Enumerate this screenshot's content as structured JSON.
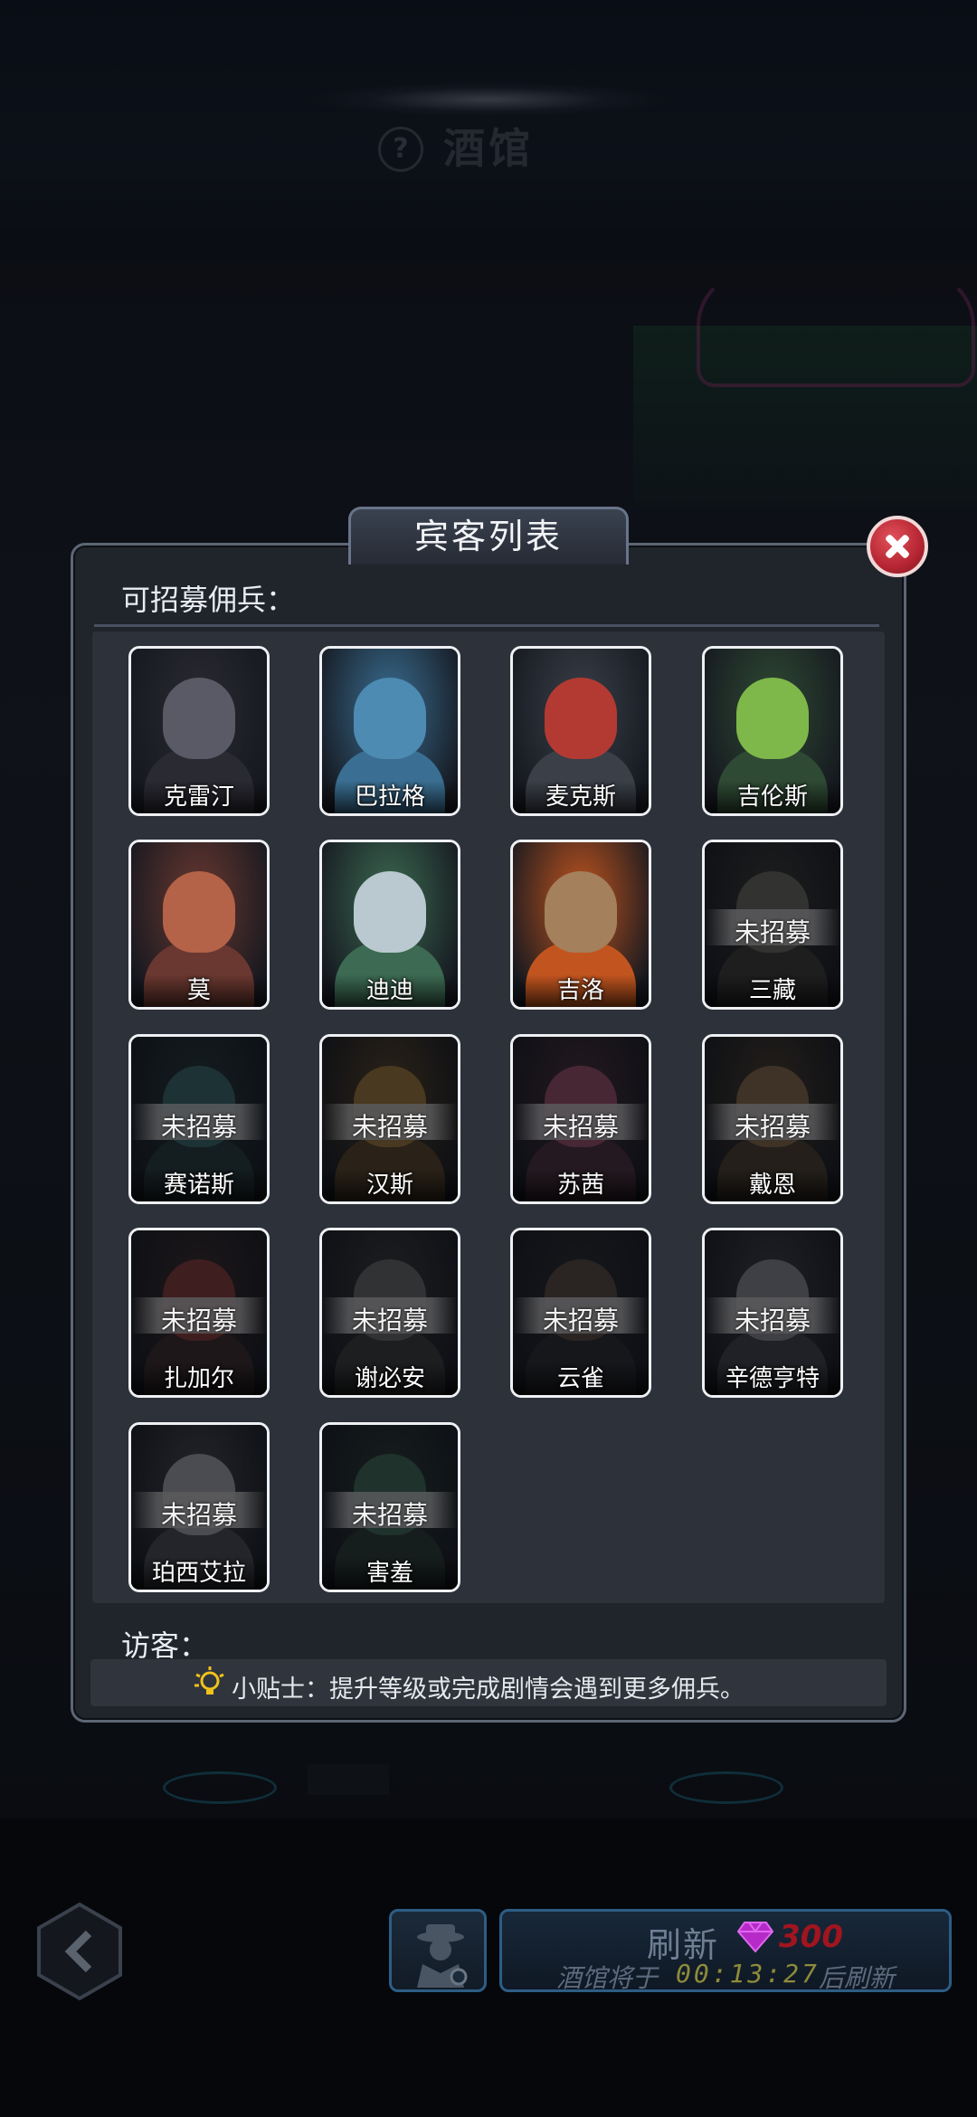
{
  "header": {
    "title": "酒馆",
    "help_icon": "question-icon"
  },
  "dialog": {
    "title": "宾客列表",
    "close_icon": "close-icon",
    "recruitable_label": "可招募佣兵：",
    "visitors_label": "访客：",
    "tip_icon": "lightbulb-icon",
    "tip_text": "小贴士：提升等级或完成剧情会遇到更多佣兵。"
  },
  "locked_label": "未招募",
  "heroes": [
    {
      "name": "克雷汀",
      "recruited": true,
      "head": "#5a5a66",
      "body": "#2a2a33"
    },
    {
      "name": "巴拉格",
      "recruited": true,
      "head": "#4d8bb3",
      "body": "#3a6e92"
    },
    {
      "name": "麦克斯",
      "recruited": true,
      "head": "#b33a32",
      "body": "#3a3f48"
    },
    {
      "name": "吉伦斯",
      "recruited": true,
      "head": "#7fb84a",
      "body": "#2f4a34"
    },
    {
      "name": "莫",
      "recruited": true,
      "head": "#b46248",
      "body": "#6a3830"
    },
    {
      "name": "迪迪",
      "recruited": true,
      "head": "#b9c9cf",
      "body": "#3c6a52"
    },
    {
      "name": "吉洛",
      "recruited": true,
      "head": "#a4805c",
      "body": "#c2551f"
    },
    {
      "name": "三藏",
      "recruited": false,
      "head": "#6d6a62",
      "body": "#3c3a36"
    },
    {
      "name": "赛诺斯",
      "recruited": false,
      "head": "#3b6a6a",
      "body": "#24383a"
    },
    {
      "name": "汉斯",
      "recruited": false,
      "head": "#a07a3a",
      "body": "#5a4426"
    },
    {
      "name": "苏茜",
      "recruited": false,
      "head": "#a0506a",
      "body": "#4a2e3a"
    },
    {
      "name": "戴恩",
      "recruited": false,
      "head": "#8a6a4a",
      "body": "#4a3c2c"
    },
    {
      "name": "扎加尔",
      "recruited": false,
      "head": "#8a3a3a",
      "body": "#3a2a2a"
    },
    {
      "name": "谢必安",
      "recruited": false,
      "head": "#6a6a6a",
      "body": "#3a3a3a"
    },
    {
      "name": "云雀",
      "recruited": false,
      "head": "#5a4a42",
      "body": "#2a2a2e"
    },
    {
      "name": "辛德亨特",
      "recruited": false,
      "head": "#8a8a92",
      "body": "#3e4048"
    },
    {
      "name": "珀西艾拉",
      "recruited": false,
      "head": "#a8a8b0",
      "body": "#4a4a52"
    },
    {
      "name": "害羞",
      "recruited": false,
      "head": "#3e6a56",
      "body": "#2a3a34"
    }
  ],
  "bottom": {
    "back_icon": "chevron-left-icon",
    "spy_icon": "spy-icon",
    "refresh_label": "刷新",
    "gem_icon": "gem-icon",
    "refresh_cost": "300",
    "refresh_prefix": "酒馆将于",
    "refresh_timer": "00:13:27",
    "refresh_suffix": "后刷新"
  },
  "colors": {
    "accent_blue": "#2d5d85",
    "close_red": "#b52532",
    "gem_purple": "#c02bd1"
  }
}
